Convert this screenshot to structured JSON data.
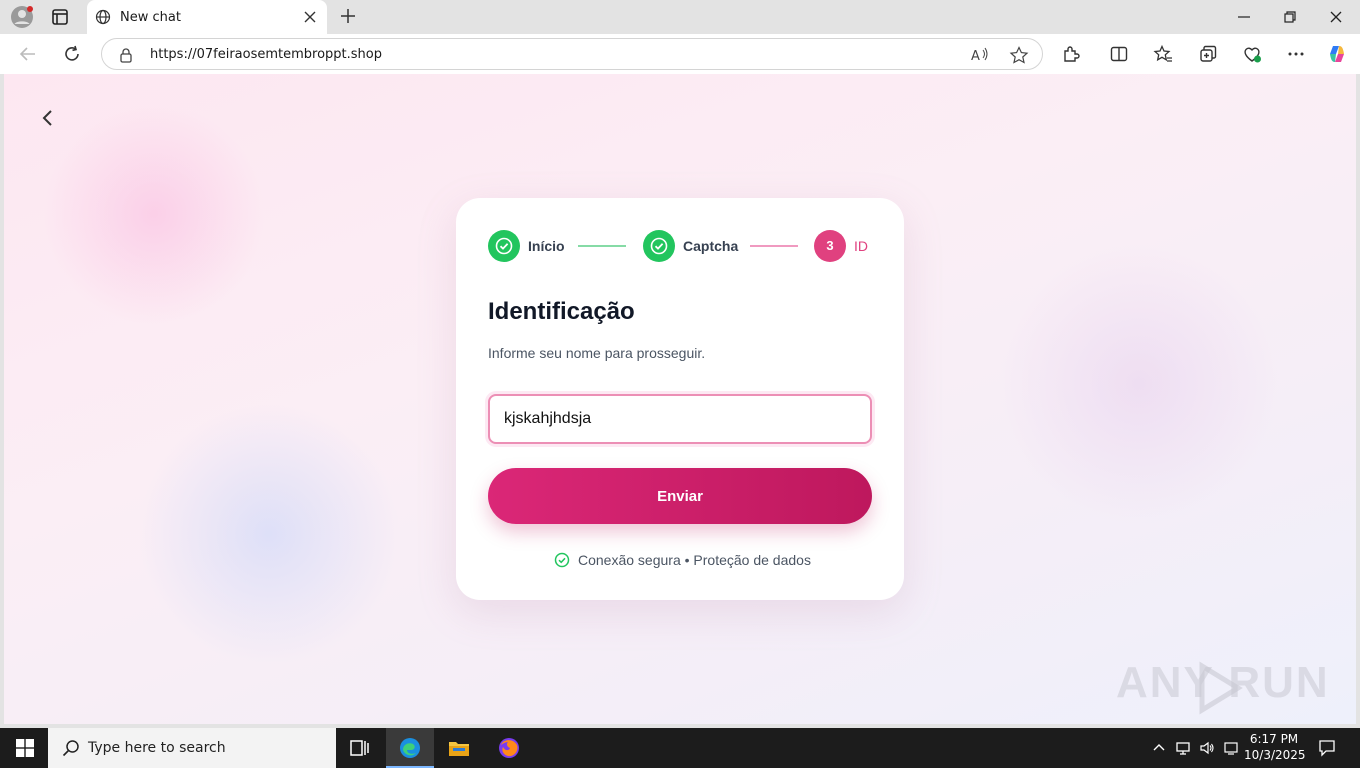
{
  "browser": {
    "tab_title": "New chat",
    "url": "https://07feiraosemtembroppt.shop"
  },
  "page": {
    "steps": [
      {
        "label": "Início",
        "state": "done"
      },
      {
        "label": "Captcha",
        "state": "done"
      },
      {
        "number": "3",
        "label": "ID",
        "state": "active"
      }
    ],
    "title": "Identificação",
    "subtitle": "Informe seu nome para prosseguir.",
    "name_value": "kjskahjhdsja",
    "submit_label": "Enviar",
    "secure_text": "Conexão segura • Proteção de dados",
    "watermark_text": "ANY  RUN"
  },
  "colors": {
    "accent": "#db2777",
    "success": "#22c55e",
    "active_step": "#e0417f"
  },
  "taskbar": {
    "search_placeholder": "Type here to search",
    "time": "6:17 PM",
    "date": "10/3/2025"
  }
}
